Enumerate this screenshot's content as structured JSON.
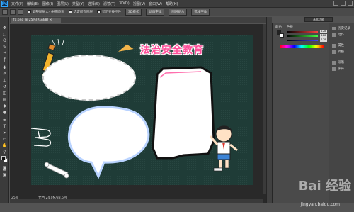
{
  "app": {
    "logo": "Ps"
  },
  "menu": [
    "文件(F)",
    "编辑(E)",
    "图像(I)",
    "图层(L)",
    "类型(Y)",
    "选择(S)",
    "滤镜(T)",
    "3D(D)",
    "视图(V)",
    "窗口(W)",
    "帮助(H)"
  ],
  "options_bar": {
    "items": [
      "调整图层大小并用原图",
      "选定所有图层",
      "显示变换控件"
    ],
    "buttons": [
      "3D模式",
      "动态字体",
      "图层组合",
      "选择字体"
    ]
  },
  "workspace": {
    "label": "基本功能"
  },
  "document_tab": {
    "title": "fa.png @ 25%(RGB/8) ×"
  },
  "canvas": {
    "title_text": "法治安全教育",
    "colors": {
      "board": "#1f3c37",
      "title": "#ff4f9a"
    }
  },
  "status": {
    "zoom": "25%",
    "doc_info": "文档:24.0M/38.5M"
  },
  "right_panel": {
    "tabs": [
      "颜色",
      "色板"
    ],
    "slider_values": [
      "128",
      "128",
      "128"
    ]
  },
  "side_panel": {
    "items": [
      "历史记录",
      "动作",
      "属性",
      "调整",
      "段落",
      "字符"
    ]
  },
  "watermark": {
    "brand": "Bai 经验",
    "url": "jingyan.baidu.com"
  }
}
